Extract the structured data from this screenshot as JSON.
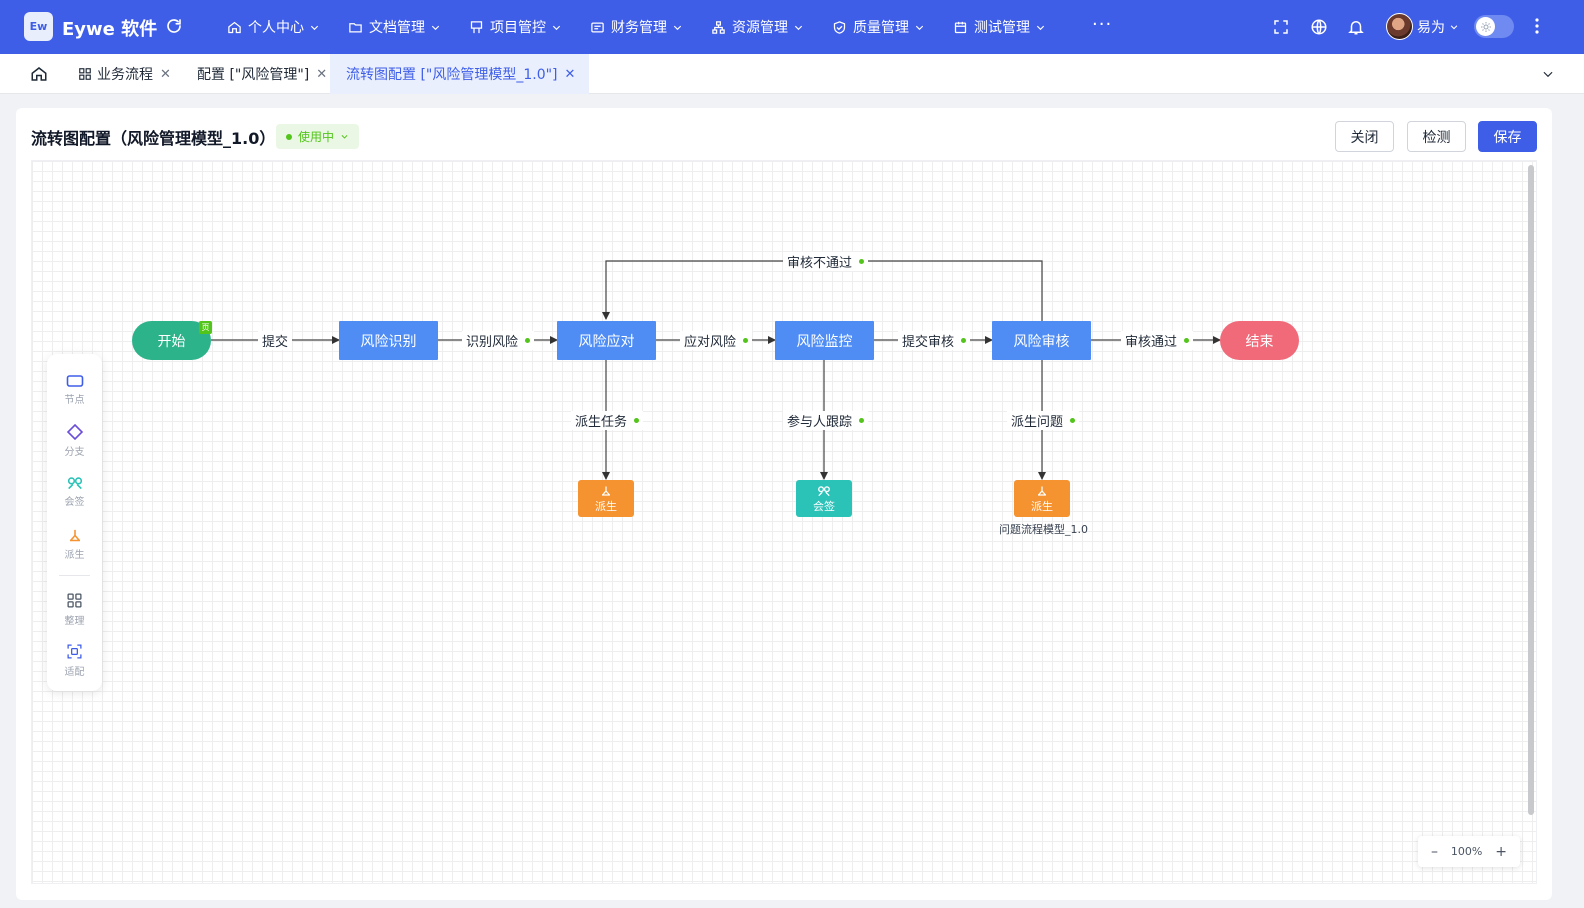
{
  "app": {
    "logo_text": "Ew",
    "brand": "Eywe 软件"
  },
  "nav": {
    "items": [
      {
        "label": "个人中心",
        "icon": "home-icon"
      },
      {
        "label": "文档管理",
        "icon": "folder-icon"
      },
      {
        "label": "项目管控",
        "icon": "flag-icon"
      },
      {
        "label": "财务管理",
        "icon": "finance-icon"
      },
      {
        "label": "资源管理",
        "icon": "org-icon"
      },
      {
        "label": "质量管理",
        "icon": "shield-icon"
      },
      {
        "label": "测试管理",
        "icon": "calendar-icon"
      }
    ],
    "more": "···"
  },
  "user": {
    "name": "易为"
  },
  "tabs": [
    {
      "label": "业务流程",
      "active": false
    },
    {
      "label": "配置 [\"风险管理\"]",
      "active": false
    },
    {
      "label": "流转图配置 [\"风险管理模型_1.0\"]",
      "active": true
    }
  ],
  "page": {
    "title": "流转图配置（风险管理模型_1.0）",
    "status": "使用中",
    "buttons": {
      "close": "关闭",
      "check": "检测",
      "save": "保存"
    }
  },
  "flow": {
    "start": {
      "label": "开始",
      "tag": "页"
    },
    "nodes": [
      "风险识别",
      "风险应对",
      "风险监控",
      "风险审核"
    ],
    "end": {
      "label": "结束"
    },
    "edges": [
      "提交",
      "识别风险",
      "应对风险",
      "提交审核",
      "审核通过",
      "审核不通过"
    ],
    "branches": [
      {
        "edge": "派生任务",
        "node": "派生",
        "node_type": "derive"
      },
      {
        "edge": "参与人跟踪",
        "node": "会签",
        "node_type": "countersign"
      },
      {
        "edge": "派生问题",
        "node": "派生",
        "node_type": "derive",
        "caption": "问题流程模型_1.0"
      }
    ],
    "colors": {
      "start": "#2db38a",
      "end": "#f06a7a",
      "task": "#4f8df5",
      "derive": "#f59330",
      "countersign": "#2bc2b8",
      "dot": "#52c41a"
    }
  },
  "palette": [
    {
      "label": "节点",
      "icon": "node-rect-icon"
    },
    {
      "label": "分支",
      "icon": "diamond-icon"
    },
    {
      "label": "会签",
      "icon": "countersign-icon"
    },
    {
      "label": "派生",
      "icon": "derive-icon"
    },
    {
      "label": "整理",
      "icon": "grid-arrange-icon"
    },
    {
      "label": "适配",
      "icon": "fit-view-icon"
    }
  ],
  "zoom": {
    "minus": "–",
    "level": "100%",
    "plus": "+"
  }
}
